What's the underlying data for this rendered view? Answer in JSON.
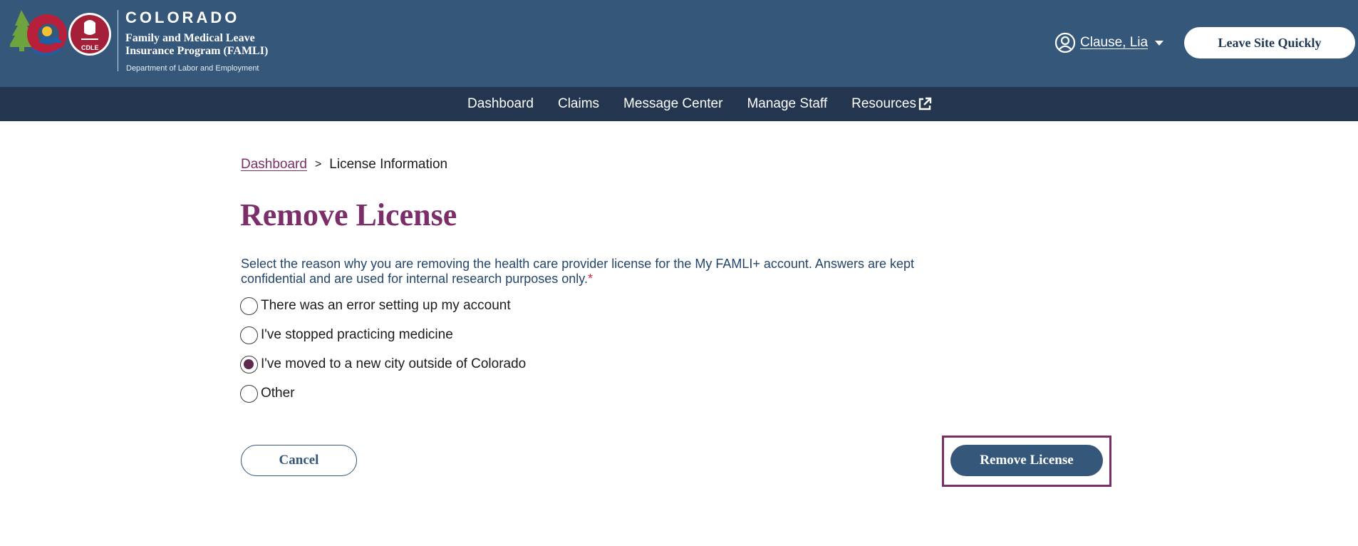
{
  "header": {
    "brand_title": "COLORADO",
    "brand_subtitle_line1": "Family and Medical Leave",
    "brand_subtitle_line2": "Insurance Program (FAMLI)",
    "department": "Department of Labor and Employment",
    "logo_badge_text": "CDLE",
    "user_name": "Clause, Lia",
    "leave_site_label": "Leave Site Quickly",
    "colors": {
      "header_bg": "#34577a",
      "nav_bg": "#24364f",
      "accent": "#7b2e68"
    }
  },
  "nav": {
    "items": [
      {
        "label": "Dashboard"
      },
      {
        "label": "Claims"
      },
      {
        "label": "Message Center"
      },
      {
        "label": "Manage Staff"
      },
      {
        "label": "Resources",
        "icon": "external-link-icon"
      }
    ]
  },
  "breadcrumb": {
    "link": "Dashboard",
    "separator": ">",
    "current": "License Information"
  },
  "page": {
    "title": "Remove License",
    "instructions": "Select the reason why you are removing the health care provider license for the My FAMLI+ account. Answers are kept confidential and are used for internal research purposes only.",
    "required_marker": "*"
  },
  "reasons": {
    "options": [
      {
        "label": "There was an error setting up my account",
        "selected": false
      },
      {
        "label": "I've stopped practicing medicine",
        "selected": false
      },
      {
        "label": "I've moved to a new city outside of Colorado",
        "selected": true
      },
      {
        "label": "Other",
        "selected": false
      }
    ]
  },
  "actions": {
    "cancel_label": "Cancel",
    "remove_label": "Remove License"
  }
}
